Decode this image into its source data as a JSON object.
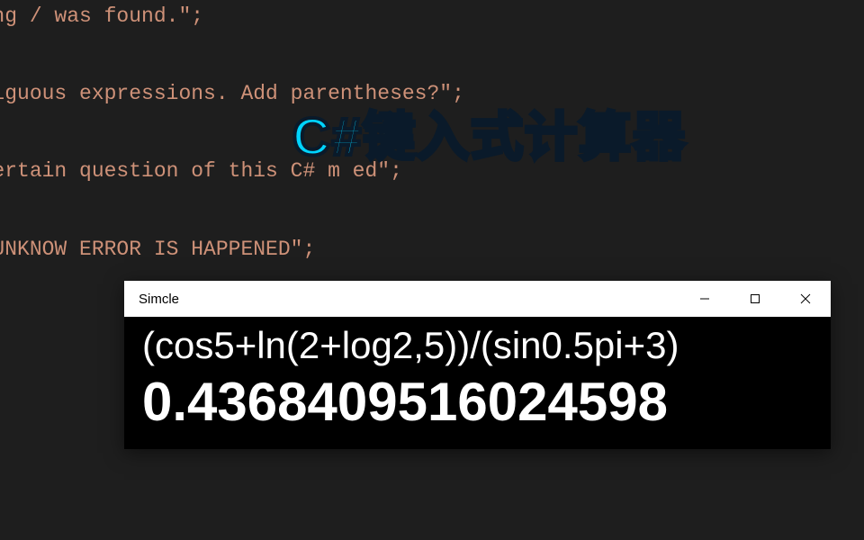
{
  "code_background": {
    "line1": "wrong     /    was found.\";",
    "line2": "Ambiguous expressions. Add parentheses?\";",
    "line3": "A certain question of this  C#  m         ed\";",
    "line4": "AN UNKNOW ERROR IS HAPPENED\";"
  },
  "title_overlay": "C#键入式计算器",
  "app_window": {
    "title": "Simcle",
    "expression": "(cos5+ln(2+log2,5))/(sin0.5pi+3)",
    "result": "0.4368409516024598"
  }
}
